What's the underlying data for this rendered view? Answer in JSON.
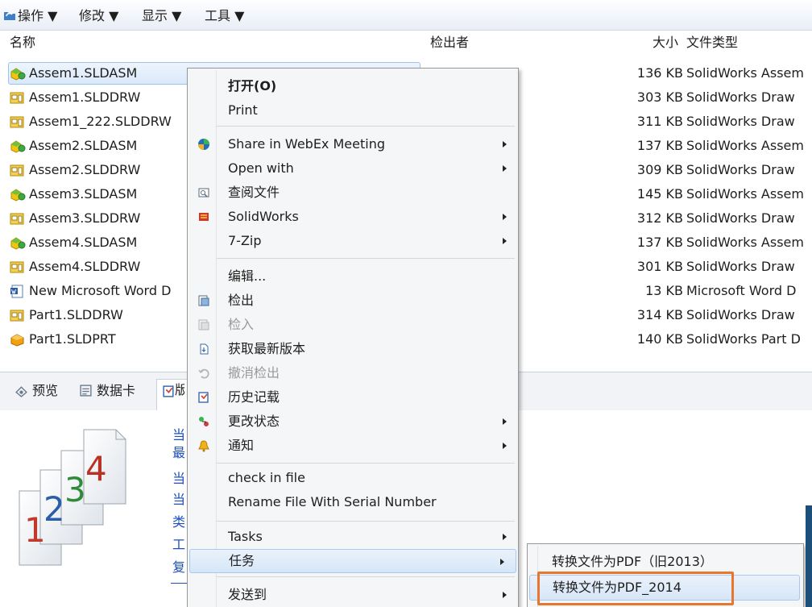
{
  "toolbar": {
    "items": [
      "操作 ▼",
      "修改 ▼",
      "显示 ▼",
      "工具 ▼"
    ]
  },
  "columns": {
    "name": "名称",
    "checked_out_by": "检出者",
    "size": "大小",
    "file_type": "文件类型"
  },
  "files": [
    {
      "name": "Assem1.SLDASM",
      "size": "136 KB",
      "type": "SolidWorks Assem",
      "icon": "assembly-icon"
    },
    {
      "name": "Assem1.SLDDRW",
      "size": "303 KB",
      "type": "SolidWorks Draw",
      "icon": "drawing-icon"
    },
    {
      "name": "Assem1_222.SLDDRW",
      "size": "311 KB",
      "type": "SolidWorks Draw",
      "icon": "drawing-icon"
    },
    {
      "name": "Assem2.SLDASM",
      "size": "137 KB",
      "type": "SolidWorks Assem",
      "icon": "assembly-icon"
    },
    {
      "name": "Assem2.SLDDRW",
      "size": "309 KB",
      "type": "SolidWorks Draw",
      "icon": "drawing-icon"
    },
    {
      "name": "Assem3.SLDASM",
      "size": "145 KB",
      "type": "SolidWorks Assem",
      "icon": "assembly-icon"
    },
    {
      "name": "Assem3.SLDDRW",
      "size": "312 KB",
      "type": "SolidWorks Draw",
      "icon": "drawing-icon"
    },
    {
      "name": "Assem4.SLDASM",
      "size": "137 KB",
      "type": "SolidWorks Assem",
      "icon": "assembly-icon"
    },
    {
      "name": "Assem4.SLDDRW",
      "size": "301 KB",
      "type": "SolidWorks Draw",
      "icon": "drawing-icon"
    },
    {
      "name": "New Microsoft Word D",
      "size": "13 KB",
      "type": "Microsoft Word D",
      "icon": "word-icon"
    },
    {
      "name": "Part1.SLDDRW",
      "size": "314 KB",
      "type": "SolidWorks Draw",
      "icon": "drawing-icon"
    },
    {
      "name": "Part1.SLDPRT",
      "size": "140 KB",
      "type": "SolidWorks Part D",
      "icon": "part-icon"
    }
  ],
  "tabs": {
    "preview": "预览",
    "datacard": "数据卡",
    "version": "版"
  },
  "version_panel": {
    "links": [
      "当",
      "最",
      "当",
      "当",
      "类",
      "工",
      "复"
    ],
    "page_numbers": [
      "1",
      "2",
      "3",
      "4"
    ],
    "colors": {
      "page1": "#c0392b",
      "page2": "#2a5fa8",
      "page3": "#2e8b3a",
      "page4": "#b83227"
    }
  },
  "context_menu": {
    "open": "打开(O)",
    "print": "Print",
    "share_webex": "Share in WebEx Meeting",
    "open_with": "Open with",
    "view_file": "查阅文件",
    "solidworks": "SolidWorks",
    "seven_zip": "7-Zip",
    "edit": "编辑...",
    "check_out": "检出",
    "check_in": "检入",
    "get_latest": "获取最新版本",
    "undo_checkout": "撤消检出",
    "history": "历史记载",
    "change_state": "更改状态",
    "notify": "通知",
    "check_in_file": "check in file",
    "rename_serial": "Rename File With Serial Number",
    "tasks": "Tasks",
    "tasks_cn": "任务",
    "send_to": "发送到"
  },
  "submenu": {
    "convert_old": "转换文件为PDF（旧2013）",
    "convert_2014": "转换文件为PDF_2014"
  },
  "accent_colors": {
    "highlight_box": "#e8762c",
    "selection": "#d9e9fb"
  }
}
